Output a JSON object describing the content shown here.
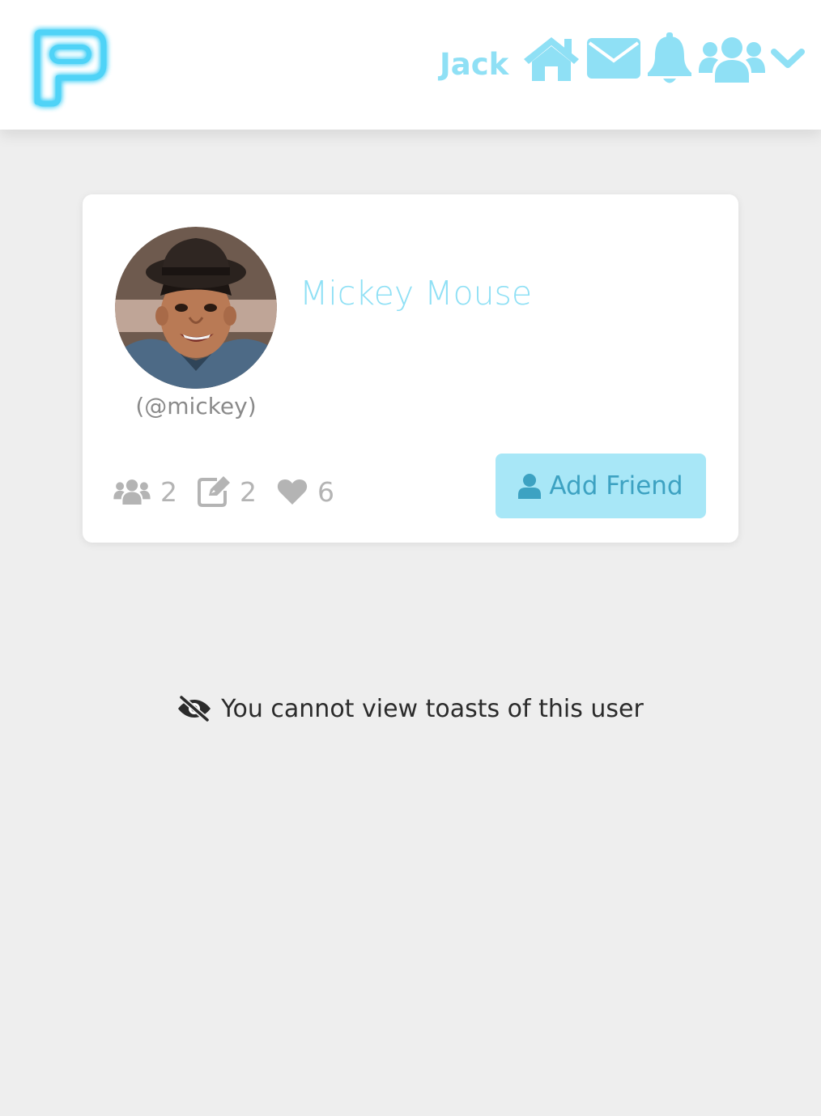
{
  "header": {
    "logo_icon": "neon-p-logo-icon",
    "user_name": "Jack",
    "icons": [
      "home-icon",
      "envelope-icon",
      "bell-icon",
      "users-icon",
      "chevron-down-icon"
    ]
  },
  "profile": {
    "display_name": "Mickey Mouse",
    "username": "(@mickey)",
    "avatar_icon": "user-avatar",
    "stats": {
      "friends": "2",
      "toasts": "2",
      "likes": "6"
    },
    "add_friend_label": "Add Friend"
  },
  "notice": {
    "text": "You cannot view toasts of this user",
    "icon": "eye-slash-icon"
  },
  "colors": {
    "accent": "#8fe0f5",
    "button_bg": "#a8e7f7",
    "button_text": "#3da2c2",
    "muted": "#b4b4b4",
    "page_bg": "#eeeeee"
  }
}
